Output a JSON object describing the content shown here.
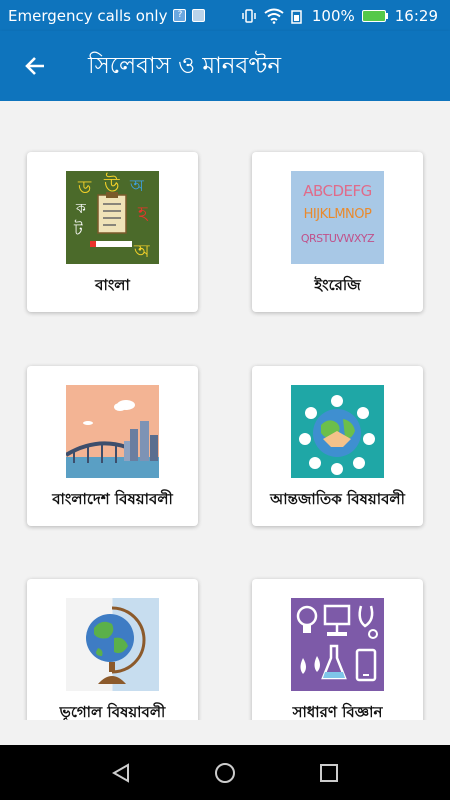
{
  "status_bar": {
    "carrier_text": "Emergency calls only",
    "battery_percent": "100%",
    "time": "16:29"
  },
  "app_bar": {
    "back_icon": "arrow-left-icon",
    "title": "সিলেবাস ও মানবণ্টন"
  },
  "subjects": [
    {
      "label": "বাংলা",
      "icon": "bangla-letters-icon"
    },
    {
      "label": "ইংরেজি",
      "icon": "english-alphabet-icon"
    },
    {
      "label": "বাংলাদেশ বিষয়াবলী",
      "icon": "bangladesh-bridge-icon"
    },
    {
      "label": "আন্তজাতিক বিষয়াবলী",
      "icon": "globe-handshake-icon"
    },
    {
      "label": "ভূগোল বিষয়াবলী",
      "icon": "desk-globe-icon"
    },
    {
      "label": "সাধারণ বিজ্ঞান",
      "icon": "science-icons-icon"
    }
  ],
  "thumb_letters": {
    "bangla": [
      "ড",
      "উ",
      "অ",
      "ক",
      "ট",
      "হ",
      "অ"
    ],
    "english": [
      "ABCDEFG",
      "HIJKLMNOP",
      "QRSTUVWXYZ"
    ]
  },
  "nav_bar": {
    "back": "triangle-back-icon",
    "home": "circle-home-icon",
    "recents": "square-recents-icon"
  },
  "colors": {
    "primary": "#0e74bd",
    "background": "#f2f2f2"
  }
}
